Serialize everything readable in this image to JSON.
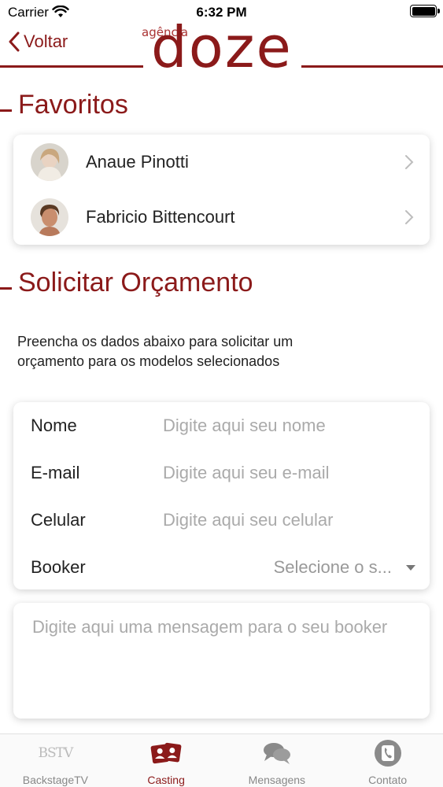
{
  "status_bar": {
    "carrier": "Carrier",
    "time": "6:32 PM"
  },
  "header": {
    "back_label": "Voltar",
    "logo_small": "agência",
    "logo_main": "doze"
  },
  "favorites": {
    "title": "Favoritos",
    "items": [
      {
        "name": "Anaue Pinotti"
      },
      {
        "name": "Fabricio Bittencourt"
      }
    ]
  },
  "quote": {
    "title": "Solicitar Orçamento",
    "description": "Preencha os dados abaixo para solicitar um orçamento para os modelos selecionados",
    "fields": {
      "name": {
        "label": "Nome",
        "placeholder": "Digite aqui seu nome"
      },
      "email": {
        "label": "E-mail",
        "placeholder": "Digite aqui seu e-mail"
      },
      "phone": {
        "label": "Celular",
        "placeholder": "Digite aqui seu celular"
      },
      "booker": {
        "label": "Booker",
        "selected": "Selecione o s..."
      }
    },
    "message_placeholder": "Digite aqui uma mensagem para o seu booker"
  },
  "tab_bar": {
    "tabs": [
      {
        "label": "BackstageTV",
        "icon_text": "BSTV"
      },
      {
        "label": "Casting"
      },
      {
        "label": "Mensagens"
      },
      {
        "label": "Contato"
      }
    ]
  },
  "colors": {
    "accent": "#8b1a1a",
    "placeholder": "#aaaaaa"
  }
}
